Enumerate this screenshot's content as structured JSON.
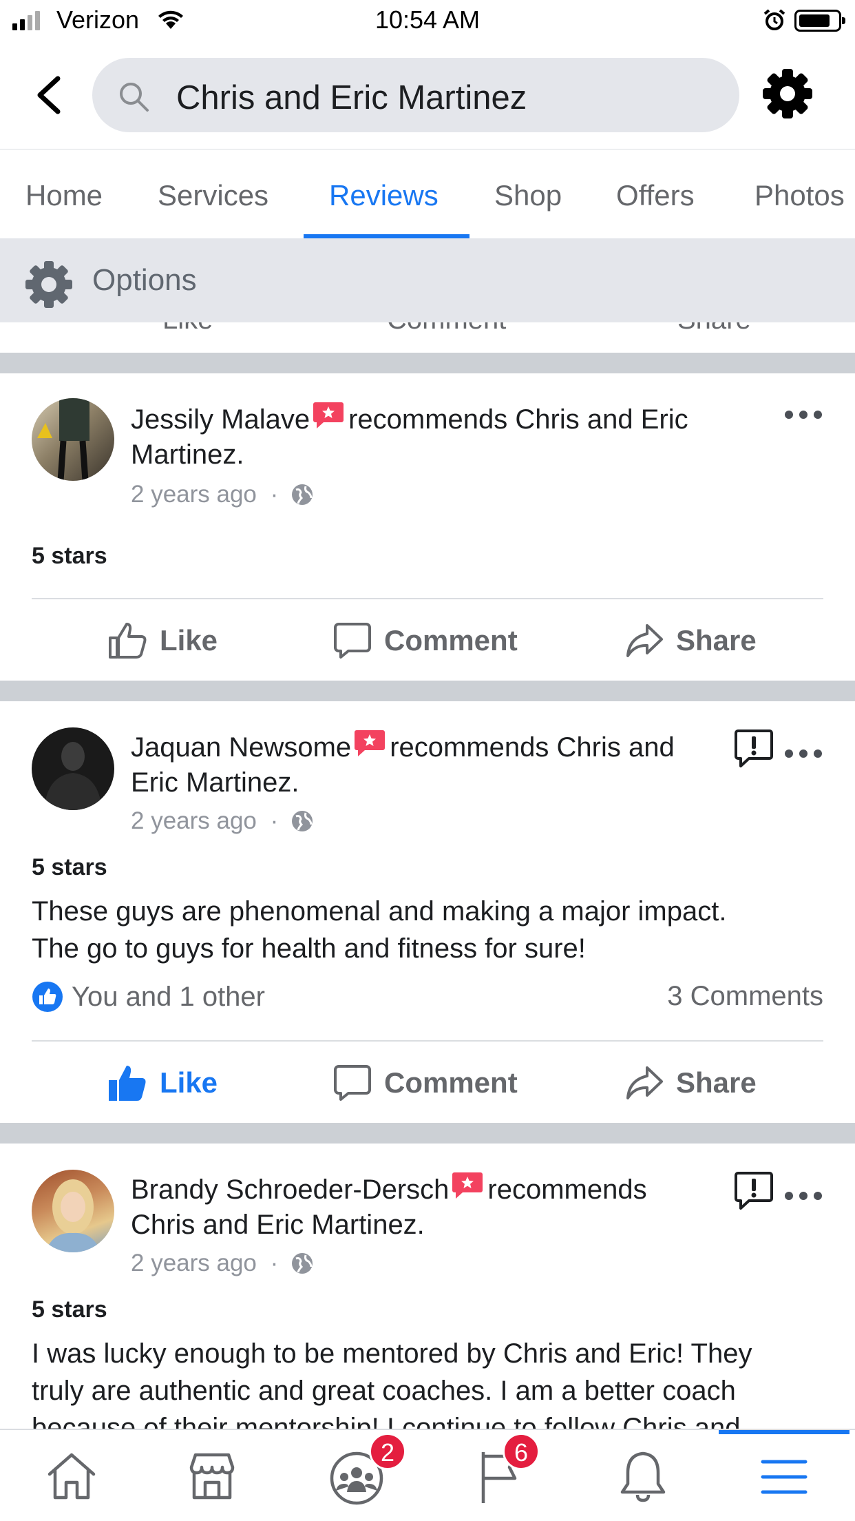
{
  "status_bar": {
    "carrier": "Verizon",
    "time": "10:54 AM"
  },
  "search": {
    "query": "Chris and Eric Martinez"
  },
  "tabs": [
    {
      "label": "Home",
      "active": false
    },
    {
      "label": "Services",
      "active": false
    },
    {
      "label": "Reviews",
      "active": true
    },
    {
      "label": "Shop",
      "active": false
    },
    {
      "label": "Offers",
      "active": false
    },
    {
      "label": "Photos",
      "active": false
    }
  ],
  "options": {
    "label": "Options"
  },
  "ghost_actions": {
    "like": "Like",
    "comment": "Comment",
    "share": "Share"
  },
  "reviews": [
    {
      "author": "Jessily Malave",
      "recommends_text": "recommends Chris and Eric Martinez.",
      "recommends_line1": "recommends Chris and Eric",
      "recommends_line2": "Martinez.",
      "time": "2 years ago",
      "separator": "·",
      "rating": "5 stars",
      "body": "",
      "like_label": "Like",
      "comment_label": "Comment",
      "share_label": "Share"
    },
    {
      "author": "Jaquan Newsome",
      "recommends_line1": "recommends Chris and",
      "recommends_line2": "Eric Martinez.",
      "time": "2 years ago",
      "separator": "·",
      "rating": "5 stars",
      "body_line1": "These guys are phenomenal and making a major impact.",
      "body_line2": "The go to guys for health and fitness for sure!",
      "reactions": "You and 1 other",
      "comments": "3 Comments",
      "liked": true,
      "like_label": "Like",
      "comment_label": "Comment",
      "share_label": "Share"
    },
    {
      "author": "Brandy Schroeder-Dersch",
      "recommends_line1": "recommends",
      "recommends_line2": "Chris and Eric Martinez.",
      "time": "2 years ago",
      "separator": "·",
      "rating": "5 stars",
      "body_line1": "I was lucky enough to be mentored by Chris and Eric!  They",
      "body_line2": "truly are authentic and great coaches.  I am a better coach",
      "body_line3": "because of their mentorship!  I continue to follow Chris and"
    }
  ],
  "bottom_nav": {
    "groups_badge": "2",
    "pages_badge": "6"
  },
  "colors": {
    "accent": "#1877f2",
    "badge_red": "#e41e3f",
    "recommend_badge": "#f3425f"
  }
}
